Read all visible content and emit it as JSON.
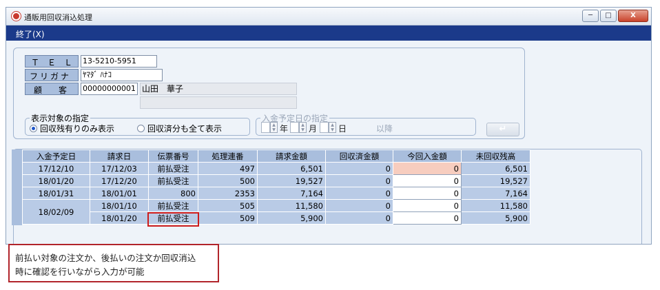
{
  "window": {
    "title": "通販用回収消込処理",
    "min_glyph": "─",
    "max_glyph": "□",
    "close_glyph": "X"
  },
  "menu": {
    "exit_label": "終了(X)"
  },
  "customer": {
    "tel_label": "Ｔ　Ｅ　Ｌ",
    "tel_value": "13-5210-5951",
    "kana_label": "フリガナ",
    "kana_value": "ﾔﾏﾀﾞ ﾊﾅｺ",
    "customer_label": "顧　　客",
    "customer_code": "00000000001",
    "customer_name": "山田　華子"
  },
  "display_filter": {
    "title": "表示対象の指定",
    "option1": "回収残有りのみ表示",
    "option2": "回収済分も全て表示",
    "selected": "option1"
  },
  "date_filter": {
    "title": "入金予定日の指定",
    "year_label": "年",
    "month_label": "月",
    "day_label": "日",
    "after_label": "以降"
  },
  "enter_button": {
    "glyph": "↵"
  },
  "grid": {
    "headers": [
      "入金予定日",
      "請求日",
      "伝票番号",
      "処理連番",
      "請求金額",
      "回収済金額",
      "今回入金額",
      "未回収残高"
    ],
    "rows": [
      {
        "scheduled": "17/12/10",
        "invoice_date": "17/12/03",
        "slip": "前払受注",
        "seq": "497",
        "amount": "6,501",
        "collected": "0",
        "payment": "0",
        "balance": "6,501"
      },
      {
        "scheduled": "18/01/20",
        "invoice_date": "17/12/20",
        "slip": "前払受注",
        "seq": "500",
        "amount": "19,527",
        "collected": "0",
        "payment": "0",
        "balance": "19,527"
      },
      {
        "scheduled": "18/01/31",
        "invoice_date": "18/01/01",
        "slip": "800",
        "seq": "2353",
        "amount": "7,164",
        "collected": "0",
        "payment": "0",
        "balance": "7,164"
      },
      {
        "scheduled": "18/02/09",
        "invoice_date": "18/01/10",
        "slip": "前払受注",
        "seq": "505",
        "amount": "11,580",
        "collected": "0",
        "payment": "0",
        "balance": "11,580"
      },
      {
        "scheduled": "",
        "invoice_date": "18/01/20",
        "slip": "前払受注",
        "seq": "509",
        "amount": "5,900",
        "collected": "0",
        "payment": "0",
        "balance": "5,900"
      }
    ]
  },
  "callout": {
    "line1": "前払い対象の注文か、後払いの注文か回収消込",
    "line2": "時に確認を行いながら入力が可能"
  },
  "colors": {
    "menubar": "#1b3a8a",
    "grid_cell": "#b9cbe6",
    "grid_header": "#a9bedd",
    "highlight": "#cc1b1b",
    "current_cell": "#f7cdbf"
  }
}
